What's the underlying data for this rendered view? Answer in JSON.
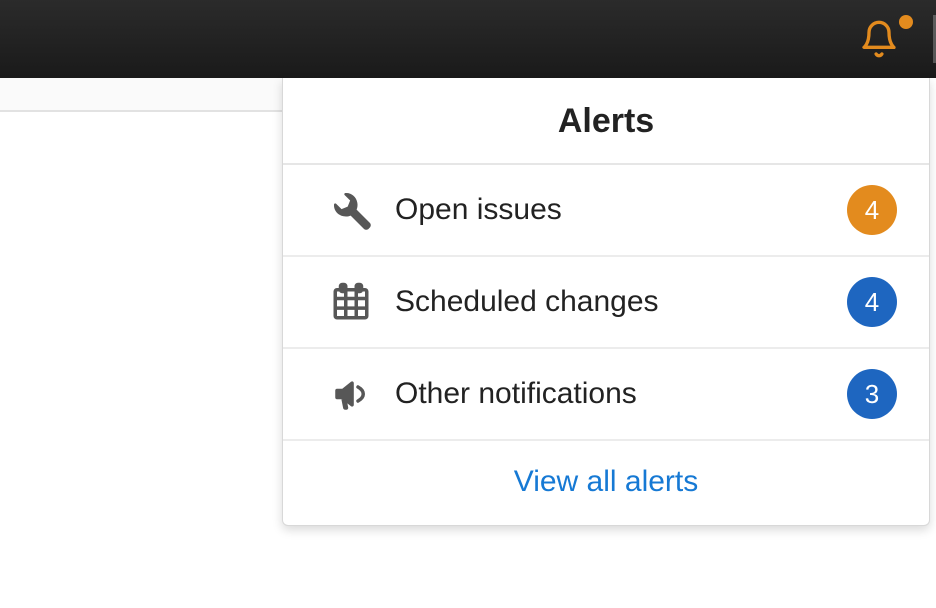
{
  "header": {
    "bell_icon": "bell-icon",
    "notification_indicator": true
  },
  "alerts_panel": {
    "title": "Alerts",
    "rows": [
      {
        "icon": "wrench-icon",
        "label": "Open issues",
        "count": "4",
        "badge_color": "orange"
      },
      {
        "icon": "calendar-icon",
        "label": "Scheduled changes",
        "count": "4",
        "badge_color": "blue"
      },
      {
        "icon": "megaphone-icon",
        "label": "Other notifications",
        "count": "3",
        "badge_color": "blue"
      }
    ],
    "footer_link": "View all alerts"
  },
  "colors": {
    "accent_orange": "#e38b1e",
    "accent_blue": "#1e66c0",
    "link_blue": "#1679d4",
    "icon_gray": "#575757"
  }
}
